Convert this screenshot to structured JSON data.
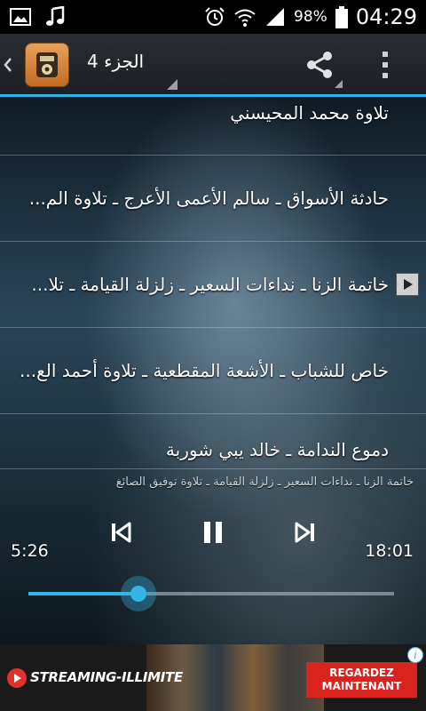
{
  "status_bar": {
    "battery_percent": "98%",
    "time": "04:29",
    "icons": [
      "image-icon",
      "music-note-icon",
      "alarm-icon",
      "wifi-icon",
      "signal-icon",
      "battery-icon"
    ]
  },
  "action_bar": {
    "part_title": "الجزء 4",
    "icons": [
      "back-chevron-icon",
      "app-logo-icon",
      "share-icon",
      "overflow-menu-icon"
    ]
  },
  "tracks": [
    {
      "title": "تلاوة محمد المحيسني",
      "playing": false
    },
    {
      "title": "حادثة الأسواق ـ سالم الأعمى الأعرج ـ تلاوة الم...",
      "playing": false
    },
    {
      "title": "خاتمة الزنا ـ نداءات السعير ـ زلزلة القيامة ـ تلا...",
      "playing": true
    },
    {
      "title": "خاص للشباب ـ الأشعة المقطعية ـ تلاوة أحمد الع...",
      "playing": false
    },
    {
      "title": "دموع الندامة ـ خالد يبي شوربة",
      "playing": false
    }
  ],
  "player": {
    "now_playing": "خاتمة الزنا ـ نداءات السعير ـ زلزلة القيامة ـ تلاوة توفيق الصائغ",
    "elapsed": "5:26",
    "total": "18:01",
    "progress_fraction": 0.3,
    "accent_color": "#33b5e5"
  },
  "ad": {
    "brand": "STREAMING-ILLIMITE",
    "cta": "REGARDEZ MAINTENANT",
    "info": "i",
    "cta_color": "#d8231f"
  }
}
